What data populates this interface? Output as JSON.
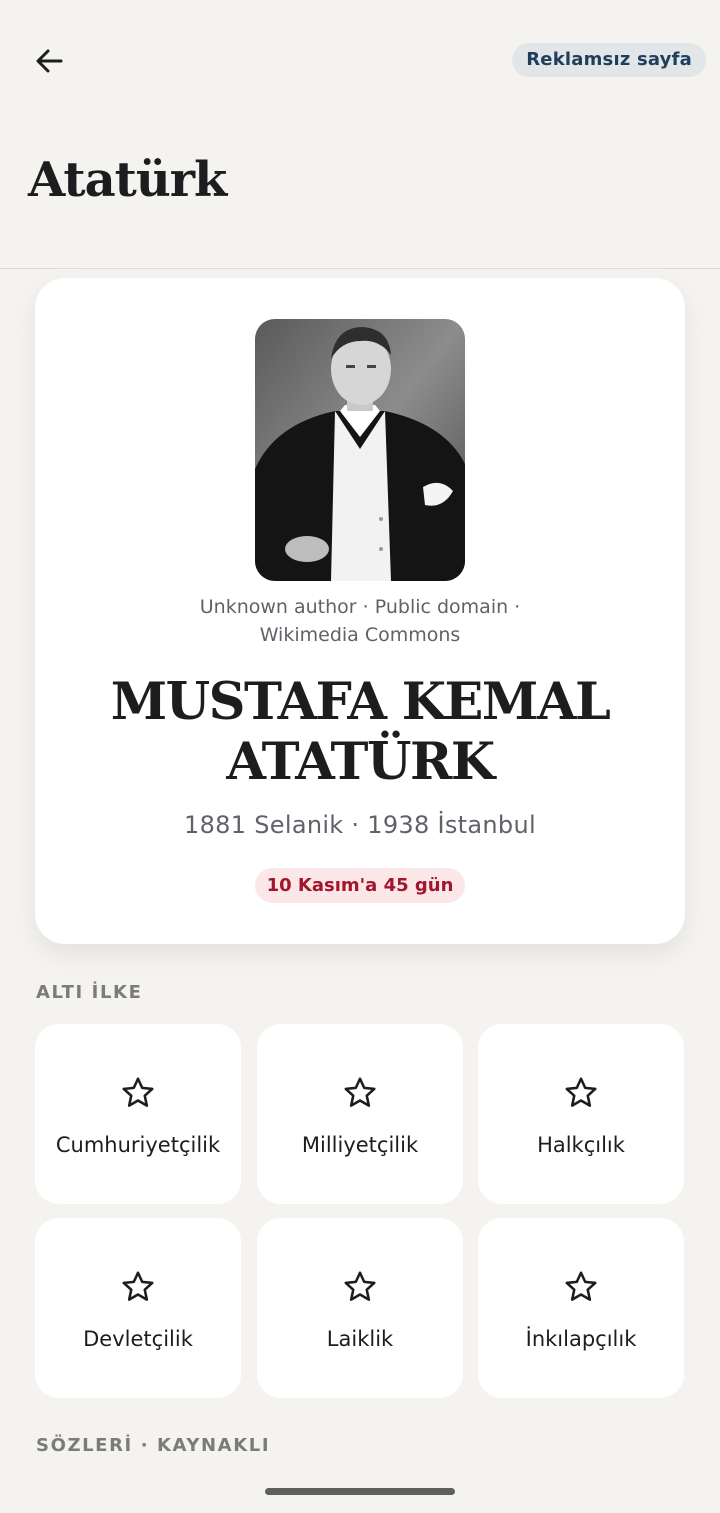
{
  "header": {
    "back_icon": "arrow-left-icon",
    "adfree_label": "Reklamsız sayfa",
    "title": "Atatürk"
  },
  "profile": {
    "credit_line1": "Unknown author · Public domain ·",
    "credit_line2": "Wikimedia Commons",
    "name_line1": "MUSTAFA KEMAL",
    "name_line2": "ATATÜRK",
    "lifespan": "1881 Selanik · 1938 İstanbul",
    "countdown": "10 Kasım'a 45 gün",
    "colors": {
      "countdown_bg": "#fbe7e8",
      "countdown_text": "#a3152c"
    }
  },
  "principles": {
    "label": "ALTI İLKE",
    "icon": "star-icon",
    "items": [
      {
        "label": "Cumhuriyetçilik"
      },
      {
        "label": "Milliyetçilik"
      },
      {
        "label": "Halkçılık"
      },
      {
        "label": "Devletçilik"
      },
      {
        "label": "Laiklik"
      },
      {
        "label": "İnkılapçılık"
      }
    ]
  },
  "quotes": {
    "label": "SÖZLERİ · KAYNAKLI"
  }
}
